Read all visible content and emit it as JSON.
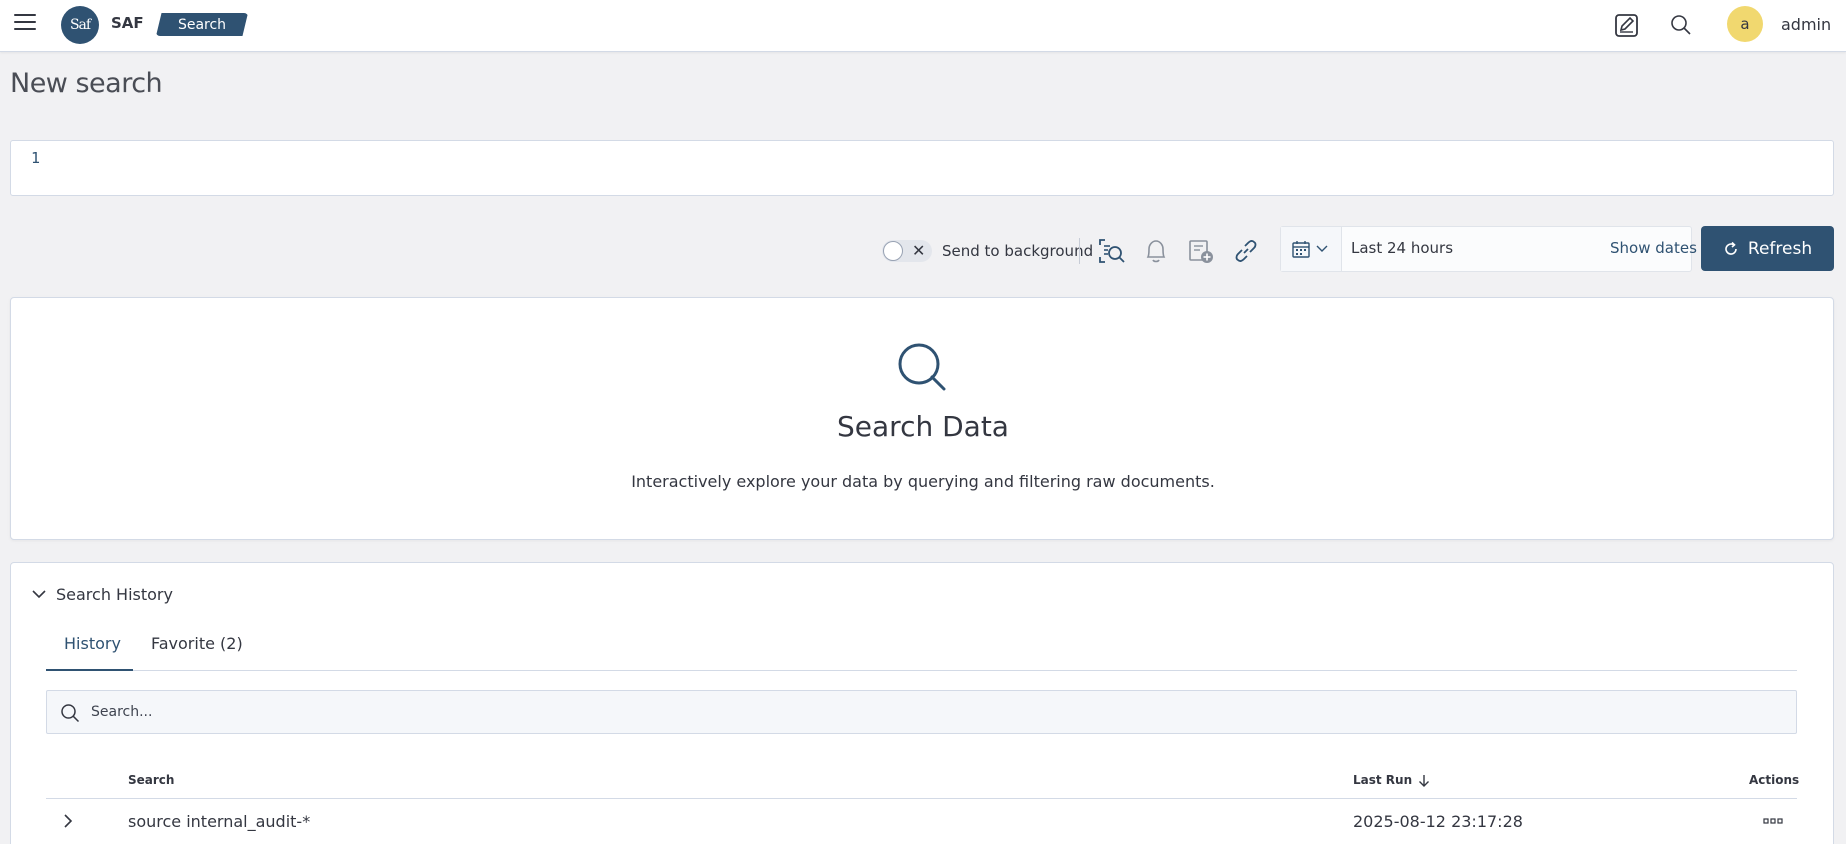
{
  "header": {
    "brand": "SAF",
    "logo_text": "Saf",
    "app_name": "Search",
    "avatar_letter": "a",
    "username": "admin",
    "icons": [
      "menu-icon",
      "edit-note-icon",
      "search-icon"
    ]
  },
  "page": {
    "title": "New search"
  },
  "query_editor": {
    "line_number": "1"
  },
  "toolbar": {
    "send_to_background_label": "Send to background",
    "send_to_background_enabled": false,
    "icons": [
      "inspect-search-icon",
      "bell-icon",
      "add-to-dashboard-icon",
      "link-icon"
    ],
    "date_range": "Last 24 hours",
    "show_dates_label": "Show dates",
    "refresh_label": "Refresh"
  },
  "empty_state": {
    "title": "Search Data",
    "description": "Interactively explore your data by querying and filtering raw documents."
  },
  "history": {
    "section_title": "Search History",
    "tabs": [
      {
        "label": "History",
        "active": true
      },
      {
        "label": "Favorite (2)",
        "active": false
      }
    ],
    "search_placeholder": "Search...",
    "columns": {
      "search": "Search",
      "last_run": "Last Run",
      "actions": "Actions"
    },
    "rows": [
      {
        "search": "source internal_audit-*",
        "last_run": "2025-08-12 23:17:28"
      }
    ]
  },
  "colors": {
    "primary": "#2f5272",
    "avatar": "#f1d86f",
    "page_bg": "#f1f1f3"
  }
}
